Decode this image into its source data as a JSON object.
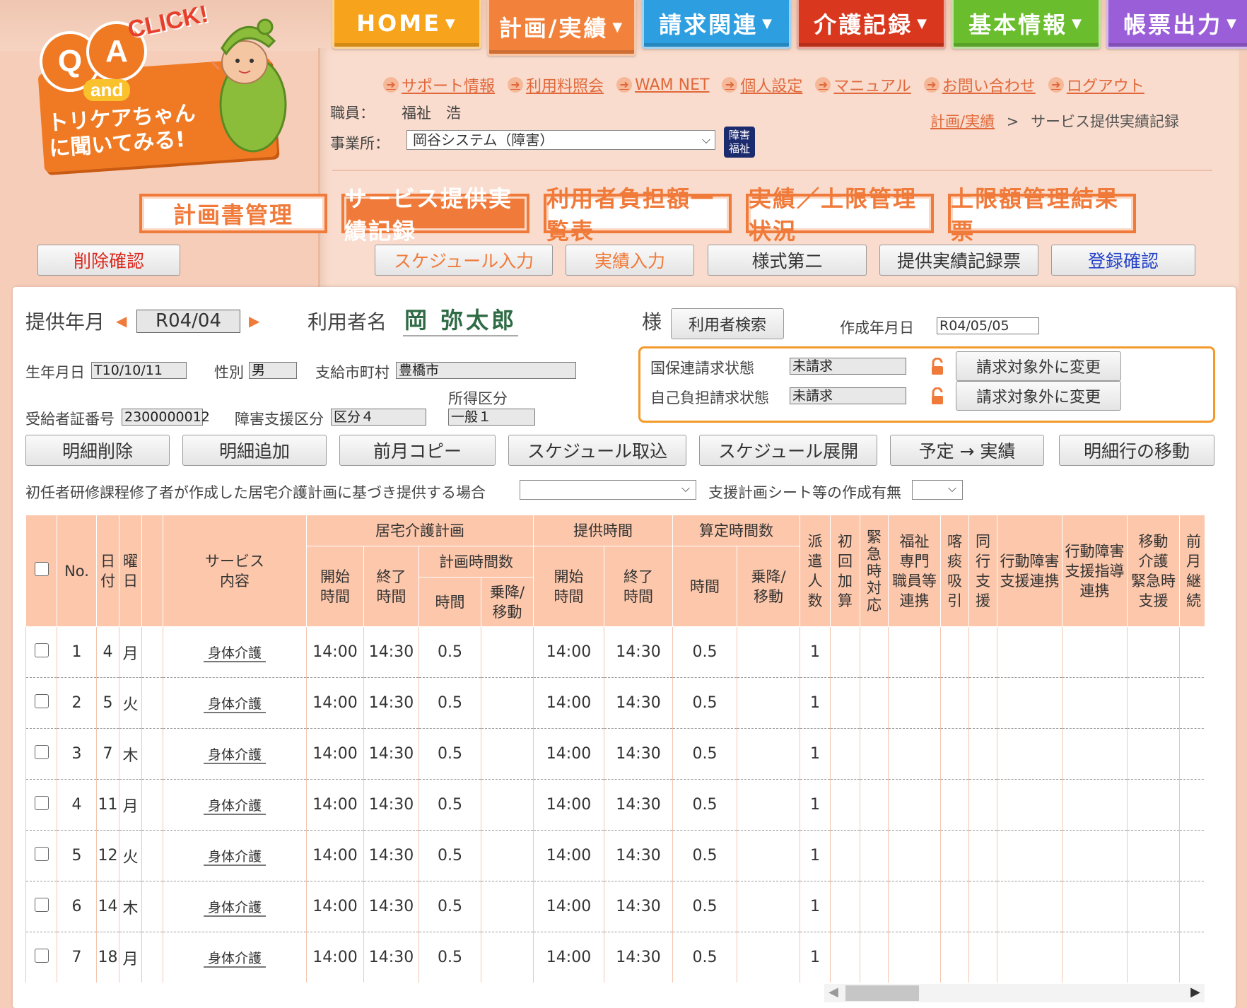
{
  "logo": {
    "q": "Q",
    "a": "A",
    "click": "CLICK!",
    "and": "and",
    "line1": "トリケアちゃん",
    "line2": "に聞いてみる!"
  },
  "topnav": [
    {
      "label": "HOME"
    },
    {
      "label": "計画/実績"
    },
    {
      "label": "請求関連"
    },
    {
      "label": "介護記録"
    },
    {
      "label": "基本情報"
    },
    {
      "label": "帳票出力"
    }
  ],
  "links": [
    "サポート情報",
    "利用料照会",
    "WAM NET",
    "個人設定",
    "マニュアル",
    "お問い合わせ",
    "ログアウト"
  ],
  "staff": {
    "label": "職員：",
    "value": "福祉　浩"
  },
  "office": {
    "label": "事業所：",
    "value": "岡谷システム（障害）",
    "badge_line1": "障害",
    "badge_line2": "福祉"
  },
  "breadcrumb": {
    "parent": "計画/実績",
    "sep": ">",
    "current": "サービス提供実績記録"
  },
  "subnav": [
    "計画書管理",
    "サービス提供実績記録",
    "利用者負担額一覧表",
    "実績／上限管理状況",
    "上限額管理結果票"
  ],
  "buttons_top": {
    "delete_confirm": "削除確認",
    "schedule_input": "スケジュール入力",
    "actual_input": "実績入力",
    "form2": "様式第二",
    "record_sheet": "提供実績記録票",
    "register_confirm": "登録確認"
  },
  "record": {
    "month_label": "提供年月",
    "month": "R04/04",
    "user_label": "利用者名",
    "user_name": "岡 弥太郎",
    "honorific": "様",
    "user_search": "利用者検索",
    "created_label": "作成年月日",
    "created": "R04/05/05",
    "birth_label": "生年月日",
    "birth": "T10/10/11",
    "gender_label": "性別",
    "gender": "男",
    "city_label": "支給市町村",
    "city": "豊橋市",
    "cert_label": "受給者証番号",
    "cert": "2300000012",
    "support_label": "障害支援区分",
    "support": "区分４",
    "income_label": "所得区分",
    "income": "一般１"
  },
  "billing": {
    "kokuho_label": "国保連請求状態",
    "kokuho_value": "未請求",
    "self_label": "自己負担請求状態",
    "self_value": "未請求",
    "change_btn": "請求対象外に変更"
  },
  "actions": [
    "明細削除",
    "明細追加",
    "前月コピー",
    "スケジュール取込",
    "スケジュール展開",
    "予定 → 実績",
    "明細行の移動"
  ],
  "options": {
    "training_label": "初任者研修課程修了者が作成した居宅介護計画に基づき提供する場合",
    "training_value": "",
    "sheet_label": "支援計画シート等の作成有無",
    "sheet_value": ""
  },
  "table": {
    "h_no": "No.",
    "h_day1": "日",
    "h_day2": "付",
    "h_wd1": "曜",
    "h_wd2": "日",
    "h_service1": "サービス",
    "h_service2": "内容",
    "h_plan": "居宅介護計画",
    "h_start1": "開始",
    "h_start2": "時間",
    "h_end1": "終了",
    "h_end2": "時間",
    "h_planhours": "計画時間数",
    "h_hours": "時間",
    "h_ride1": "乗降/",
    "h_ride2": "移動",
    "h_provide": "提供時間",
    "h_calc": "算定時間数",
    "h_dispatch": [
      "派",
      "遣",
      "人",
      "数"
    ],
    "h_first": [
      "初",
      "回",
      "加",
      "算"
    ],
    "h_emergency": [
      "緊",
      "急",
      "時",
      "対",
      "応"
    ],
    "h_welfare": [
      "福祉",
      "専門",
      "職員等",
      "連携"
    ],
    "h_suction": [
      "喀",
      "痰",
      "吸",
      "引"
    ],
    "h_accomp": [
      "同",
      "行",
      "支",
      "援"
    ],
    "h_behav1": "行動障害",
    "h_behav2": "支援連携",
    "h_behavguide": [
      "行動障害",
      "支援指導",
      "連携"
    ],
    "h_move": [
      "移動",
      "介護",
      "緊急時",
      "支援"
    ],
    "h_prev": [
      "前",
      "月",
      "継",
      "続"
    ],
    "rows": [
      {
        "no": "1",
        "day": "4",
        "wd": "月",
        "service": "身体介護",
        "ps": "14:00",
        "pe": "14:30",
        "ph": "0.5",
        "as": "14:00",
        "ae": "14:30",
        "ah": "0.5",
        "disp": "1"
      },
      {
        "no": "2",
        "day": "5",
        "wd": "火",
        "service": "身体介護",
        "ps": "14:00",
        "pe": "14:30",
        "ph": "0.5",
        "as": "14:00",
        "ae": "14:30",
        "ah": "0.5",
        "disp": "1"
      },
      {
        "no": "3",
        "day": "7",
        "wd": "木",
        "service": "身体介護",
        "ps": "14:00",
        "pe": "14:30",
        "ph": "0.5",
        "as": "14:00",
        "ae": "14:30",
        "ah": "0.5",
        "disp": "1"
      },
      {
        "no": "4",
        "day": "11",
        "wd": "月",
        "service": "身体介護",
        "ps": "14:00",
        "pe": "14:30",
        "ph": "0.5",
        "as": "14:00",
        "ae": "14:30",
        "ah": "0.5",
        "disp": "1"
      },
      {
        "no": "5",
        "day": "12",
        "wd": "火",
        "service": "身体介護",
        "ps": "14:00",
        "pe": "14:30",
        "ph": "0.5",
        "as": "14:00",
        "ae": "14:30",
        "ah": "0.5",
        "disp": "1"
      },
      {
        "no": "6",
        "day": "14",
        "wd": "木",
        "service": "身体介護",
        "ps": "14:00",
        "pe": "14:30",
        "ph": "0.5",
        "as": "14:00",
        "ae": "14:30",
        "ah": "0.5",
        "disp": "1"
      },
      {
        "no": "7",
        "day": "18",
        "wd": "月",
        "service": "身体介護",
        "ps": "14:00",
        "pe": "14:30",
        "ph": "0.5",
        "as": "14:00",
        "ae": "14:30",
        "ah": "0.5",
        "disp": "1"
      }
    ]
  },
  "colors": {
    "accent": "#f07a3a",
    "header_bg": "#fcc7ab",
    "billing_border": "#f39a2a",
    "name_green": "#2f6b45"
  }
}
